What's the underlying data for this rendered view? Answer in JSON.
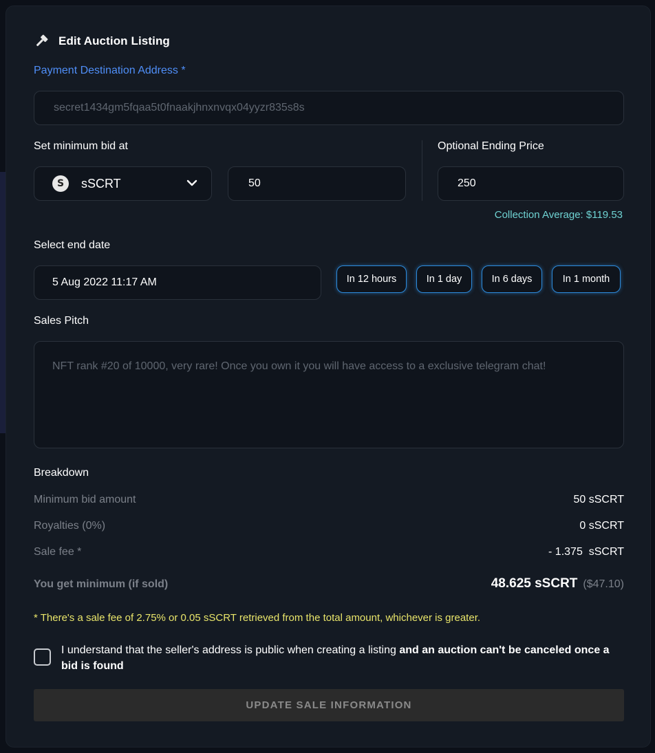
{
  "title": "Edit Auction Listing",
  "payment": {
    "label": "Payment Destination Address *",
    "value": "secret1434gm5fqaa5t0fnaakjhnxnvqx04yyzr835s8s"
  },
  "min_bid": {
    "label": "Set minimum bid at",
    "token": "sSCRT",
    "amount": "50"
  },
  "ending_price": {
    "label": "Optional Ending Price",
    "value": "250"
  },
  "collection_average": "Collection Average: $119.53",
  "end_date": {
    "label": "Select end date",
    "value": "5 Aug 2022 11:17 AM",
    "quick": [
      "In 12 hours",
      "In 1 day",
      "In 6 days",
      "In 1 month"
    ]
  },
  "sales_pitch": {
    "label": "Sales Pitch",
    "placeholder": "NFT rank #20 of 10000, very rare! Once you own it you will have access to a exclusive telegram chat!"
  },
  "breakdown": {
    "label": "Breakdown",
    "rows": [
      {
        "key": "Minimum bid amount",
        "value": "50 sSCRT"
      },
      {
        "key": "Royalties (0%)",
        "value": "0 sSCRT"
      },
      {
        "key": "Sale fee *",
        "value": "- 1.375  sSCRT"
      }
    ],
    "total_label": "You get minimum (if sold)",
    "total_value": "48.625 sSCRT",
    "total_usd": "($47.10)"
  },
  "fee_note": "* There's a sale fee of 2.75% or 0.05 sSCRT retrieved from the total amount, whichever is greater.",
  "agree": {
    "text_normal": "I understand that the seller's address is public when creating a listing ",
    "text_bold": "and an auction can't be canceled once a bid is found"
  },
  "submit_label": "UPDATE SALE INFORMATION",
  "colors": {
    "accent_blue": "#4f8ef7",
    "quick_border": "#2d8bdc",
    "teal": "#6fd3d3",
    "note_yellow": "#e9e56a"
  }
}
